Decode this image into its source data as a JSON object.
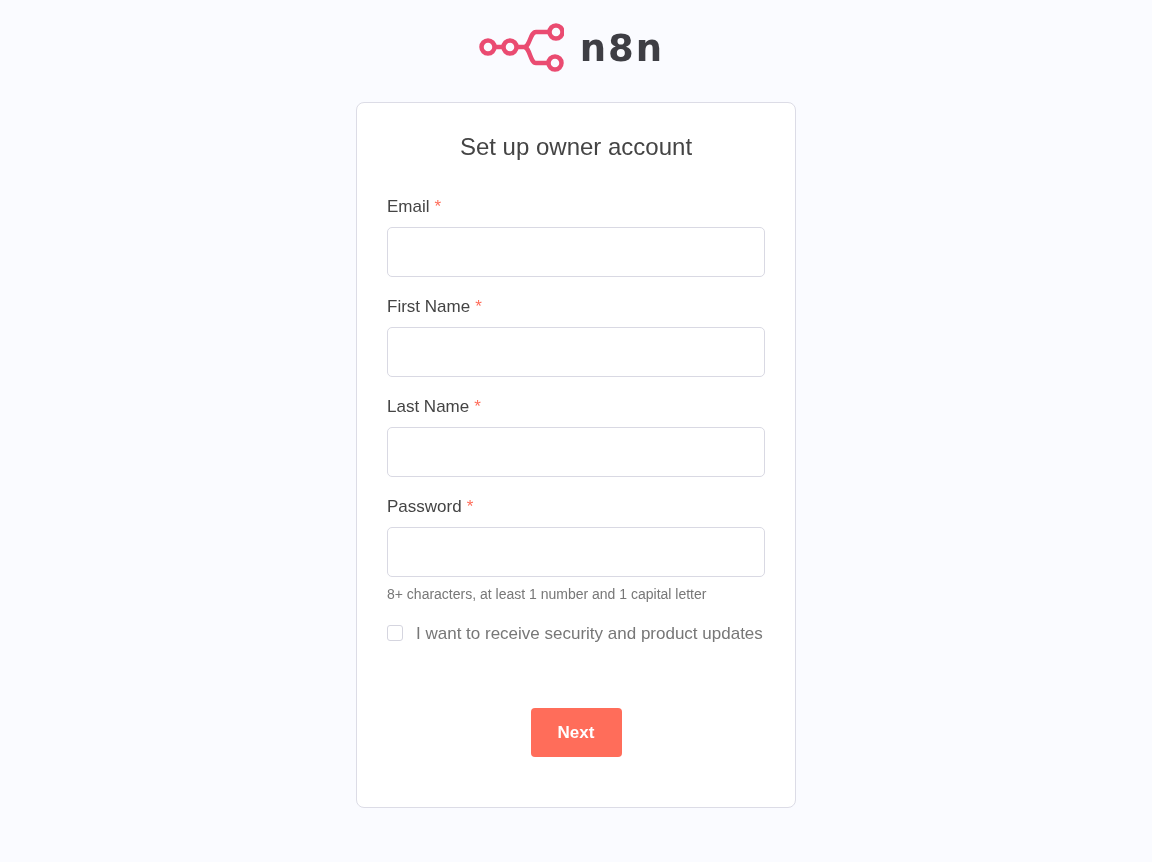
{
  "brand": {
    "name": "n8n"
  },
  "form": {
    "title": "Set up owner account",
    "fields": [
      {
        "label": "Email",
        "required_mark": "*"
      },
      {
        "label": "First Name",
        "required_mark": "*"
      },
      {
        "label": "Last Name",
        "required_mark": "*"
      },
      {
        "label": "Password",
        "required_mark": "*",
        "hint": "8+ characters, at least 1 number and 1 capital letter"
      }
    ],
    "consent": {
      "label": "I want to receive security and product updates",
      "checked": false
    },
    "submit": "Next"
  }
}
